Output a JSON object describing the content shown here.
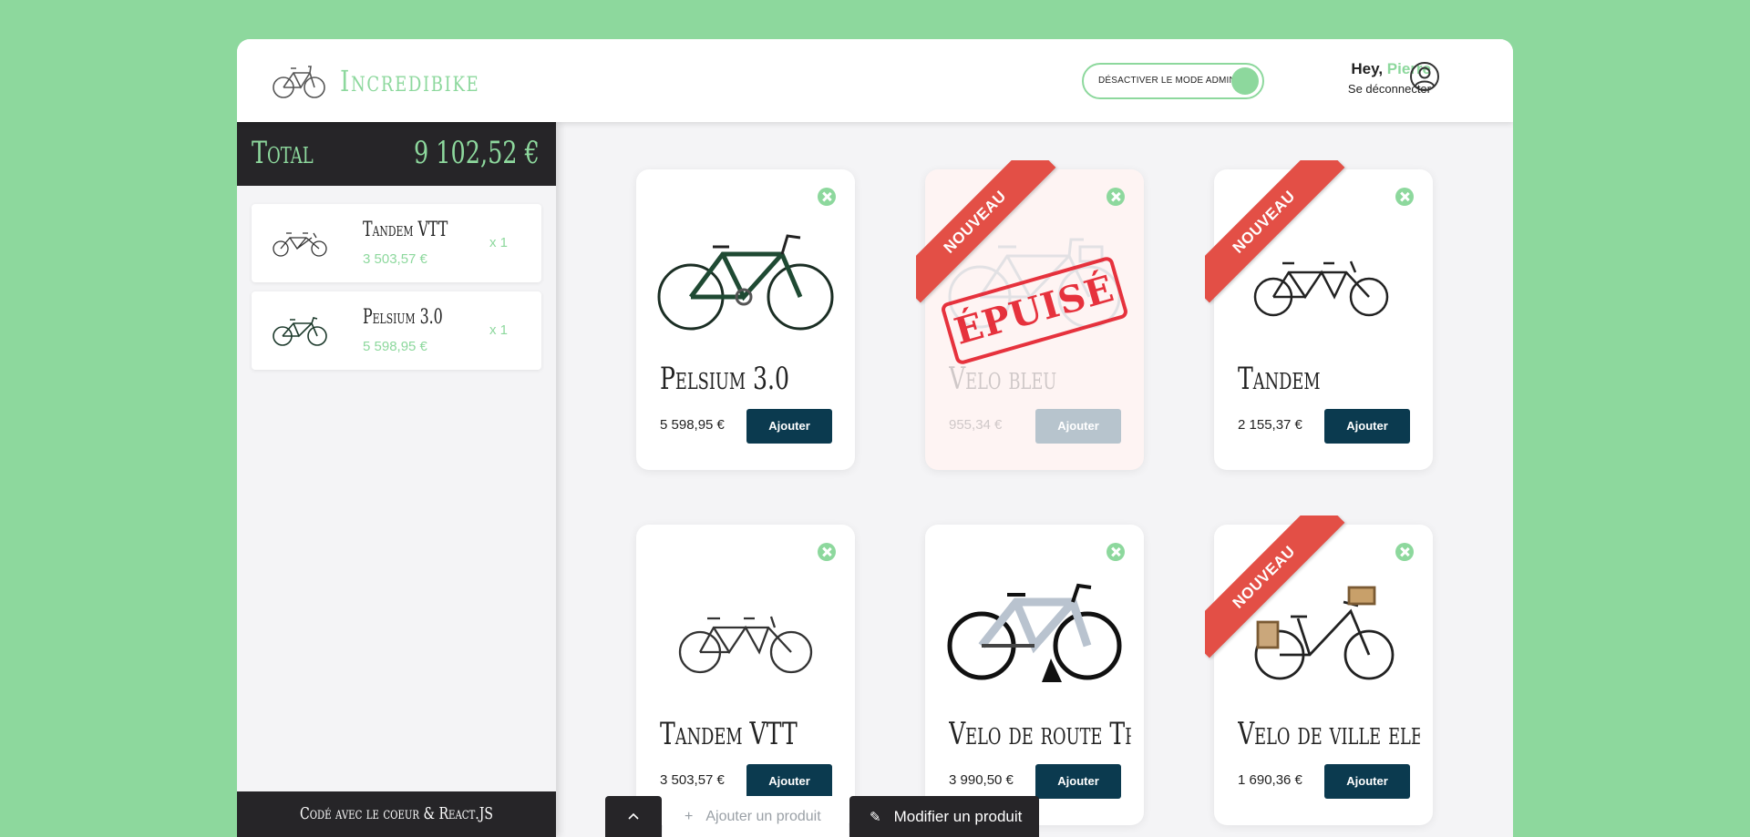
{
  "header": {
    "brand": "Incredibike",
    "admin_toggle_label": "DÉSACTIVER LE MODE ADMIN",
    "greeting": "Hey,",
    "user_name": "Pierre",
    "logout": "Se déconnecter"
  },
  "cart": {
    "total_label": "Total",
    "total_value": "9 102,52 €",
    "items": [
      {
        "name": "Tandem VTT",
        "price": "3 503,57 €",
        "qty": "x 1"
      },
      {
        "name": "Pelsium 3.0",
        "price": "5 598,95 €",
        "qty": "x 1"
      }
    ],
    "footer": "Codé avec le coeur & React.JS"
  },
  "products": [
    {
      "name": "Pelsium 3.0",
      "price": "5 598,95 €",
      "button": "Ajouter"
    },
    {
      "name": "Velo bleu",
      "price": "955,34 €",
      "button": "Ajouter",
      "ribbon": "NOUVEAU",
      "stamp": "ÉPUISÉ"
    },
    {
      "name": "Tandem",
      "price": "2 155,37 €",
      "button": "Ajouter",
      "ribbon": "NOUVEAU"
    },
    {
      "name": "Tandem VTT",
      "price": "3 503,57 €",
      "button": "Ajouter"
    },
    {
      "name": "Velo de route Tr...",
      "price": "3 990,50 €",
      "button": "Ajouter"
    },
    {
      "name": "Velo de ville ele...",
      "price": "1 690,36 €",
      "button": "Ajouter",
      "ribbon": "NOUVEAU"
    }
  ],
  "toolbar": {
    "add_label": "Ajouter un produit",
    "edit_label": "Modifier un produit"
  },
  "colors": {
    "accent": "#8dd89d",
    "dark": "#262528",
    "button": "#0b3a4f",
    "ribbon": "#e34f46"
  }
}
